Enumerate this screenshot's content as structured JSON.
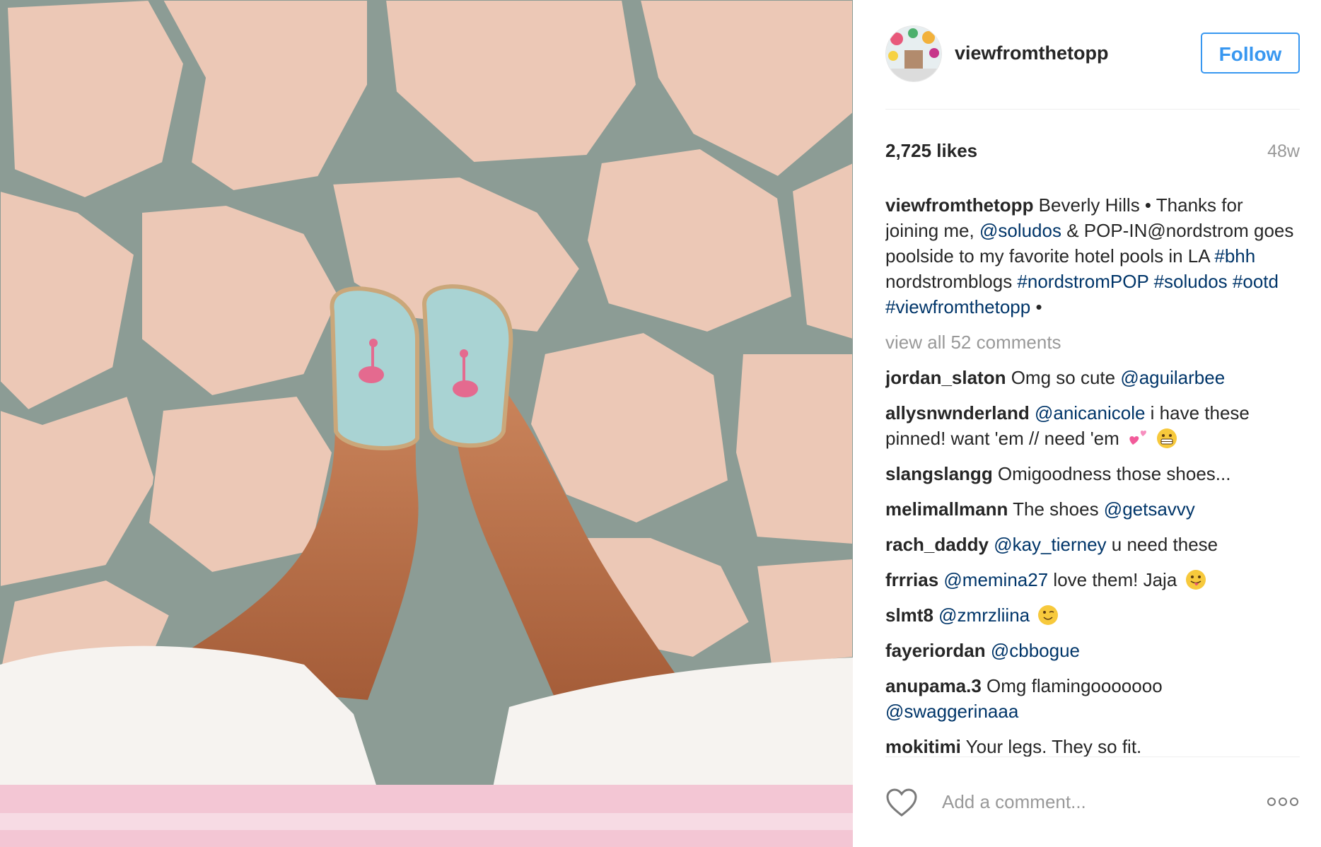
{
  "post": {
    "photo_icon": "photo-flamingo-espadrilles",
    "username": "viewfromthetopp",
    "follow_label": "Follow",
    "likes": "2,725 likes",
    "time": "48w",
    "caption": {
      "user": "viewfromthetopp",
      "t1": " Beverly Hills • Thanks for joining me, ",
      "m1": "@soludos",
      "t2": " & POP-IN@nordstrom goes poolside to my favorite hotel pools in LA ",
      "m2": "#bhh",
      "t3": " nordstromblogs ",
      "m3": "#nordstromPOP",
      "t4": " ",
      "m4": "#soludos",
      "t5": " ",
      "m5": "#ootd",
      "t6": " ",
      "m6": "#viewfromthetopp",
      "t7": " •"
    },
    "view_all": "view all 52 comments",
    "comments": [
      {
        "user": "jordan_slaton",
        "t1": " Omg so cute ",
        "m1": "@aguilarbee"
      },
      {
        "user": "allysnwnderland",
        "t0": " ",
        "m1": "@anicanicole",
        "t1": " i have these pinned! want 'em // need 'em",
        "emoji": [
          "two-hearts-icon",
          "grimacing-face-icon"
        ]
      },
      {
        "user": "slangslangg",
        "t1": " Omigoodness those shoes..."
      },
      {
        "user": "melimallmann",
        "t1": " The shoes ",
        "m1": "@getsavvy"
      },
      {
        "user": "rach_daddy",
        "t0": " ",
        "m1": "@kay_tierney",
        "t1": " u need these"
      },
      {
        "user": "frrrias",
        "t0": " ",
        "m1": "@memina27",
        "t1": " love them! Jaja",
        "emoji": [
          "tongue-face-icon"
        ]
      },
      {
        "user": "slmt8",
        "t0": " ",
        "m1": "@zmrzliina",
        "emoji": [
          "wink-face-icon"
        ]
      },
      {
        "user": "fayeriordan",
        "t0": " ",
        "m1": "@cbbogue"
      },
      {
        "user": "anupama.3",
        "t1": " Omg flamingooooooo ",
        "m1": "@swaggerinaaa"
      },
      {
        "user": "mokitimi",
        "t1": " Your legs. They so fit."
      }
    ],
    "comment_placeholder": "Add a comment...",
    "icons": {
      "like": "heart-icon",
      "more": "more-options-icon"
    },
    "colors": {
      "link": "#003569",
      "follow": "#3897f0",
      "muted": "#999999"
    }
  }
}
